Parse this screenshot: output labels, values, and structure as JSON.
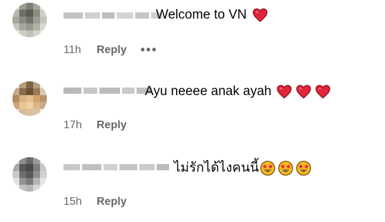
{
  "comments": [
    {
      "text": "Welcome to VN",
      "emoji": [
        "red-heart"
      ],
      "time": "11h",
      "reply_label": "Reply",
      "more_label": "•••"
    },
    {
      "text": "Ayu neeee anak ayah",
      "emoji": [
        "red-heart",
        "red-heart",
        "red-heart"
      ],
      "time": "17h",
      "reply_label": "Reply"
    },
    {
      "text": "ไม่รักได้ไงคนนี้",
      "emoji": [
        "star-struck-face",
        "star-struck-face",
        "star-struck-face"
      ],
      "time": "15h",
      "reply_label": "Reply"
    }
  ],
  "colors": {
    "meta_text": "#65676b",
    "heart": "#e0243a",
    "emoji_face": "#f7b928"
  }
}
